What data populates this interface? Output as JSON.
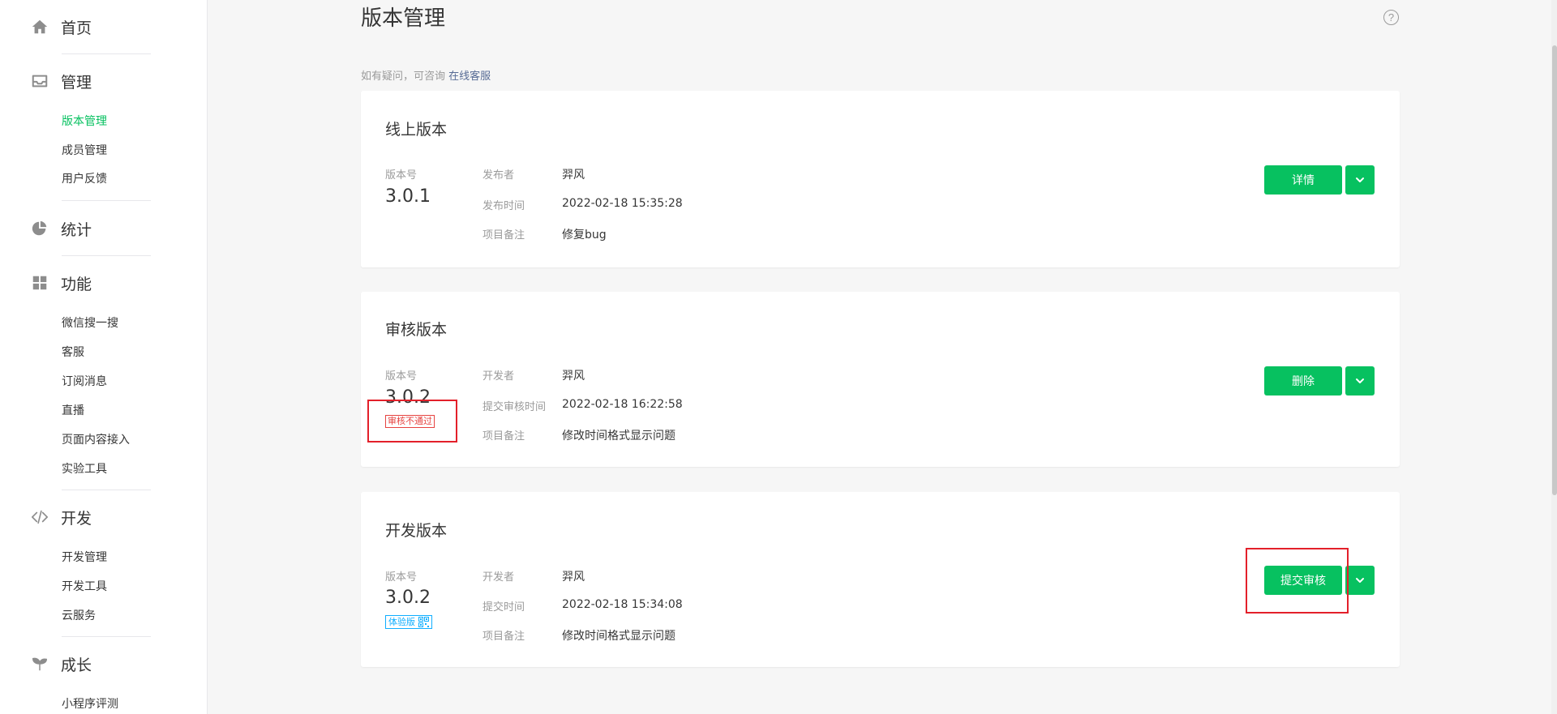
{
  "sidebar": {
    "home": {
      "label": "首页",
      "icon": "home-icon"
    },
    "manage": {
      "label": "管理",
      "icon": "inbox-icon",
      "items": [
        {
          "label": "版本管理",
          "active": true
        },
        {
          "label": "成员管理"
        },
        {
          "label": "用户反馈"
        }
      ]
    },
    "stats": {
      "label": "统计",
      "icon": "pie-chart-icon"
    },
    "features": {
      "label": "功能",
      "icon": "grid-icon",
      "items": [
        {
          "label": "微信搜一搜"
        },
        {
          "label": "客服"
        },
        {
          "label": "订阅消息"
        },
        {
          "label": "直播"
        },
        {
          "label": "页面内容接入"
        },
        {
          "label": "实验工具"
        }
      ]
    },
    "develop": {
      "label": "开发",
      "icon": "code-icon",
      "items": [
        {
          "label": "开发管理"
        },
        {
          "label": "开发工具"
        },
        {
          "label": "云服务"
        }
      ]
    },
    "growth": {
      "label": "成长",
      "icon": "sprout-icon",
      "items": [
        {
          "label": "小程序评测"
        }
      ]
    }
  },
  "main": {
    "title": "版本管理",
    "hint_prefix": "如有疑问，可咨询 ",
    "hint_link": "在线客服",
    "cards": [
      {
        "title": "线上版本",
        "version_label": "版本号",
        "version": "3.0.1",
        "meta": [
          {
            "key": "发布者",
            "value": "羿风"
          },
          {
            "key": "发布时间",
            "value": "2022-02-18 15:35:28"
          },
          {
            "key": "项目备注",
            "value": "修复bug"
          }
        ],
        "button": "详情"
      },
      {
        "title": "审核版本",
        "version_label": "版本号",
        "version": "3.0.2",
        "tag": "审核不通过",
        "meta": [
          {
            "key": "开发者",
            "value": "羿风"
          },
          {
            "key": "提交审核时间",
            "value": "2022-02-18 16:22:58"
          },
          {
            "key": "项目备注",
            "value": "修改时间格式显示问题"
          }
        ],
        "button": "删除"
      },
      {
        "title": "开发版本",
        "version_label": "版本号",
        "version": "3.0.2",
        "tag": "体验版",
        "meta": [
          {
            "key": "开发者",
            "value": "羿风"
          },
          {
            "key": "提交时间",
            "value": "2022-02-18 15:34:08"
          },
          {
            "key": "项目备注",
            "value": "修改时间格式显示问题"
          }
        ],
        "button": "提交审核"
      }
    ]
  },
  "colors": {
    "accent": "#07c160",
    "link": "#576b95",
    "danger": "#e64340",
    "info": "#10aeff",
    "annotation": "#e3202a"
  }
}
